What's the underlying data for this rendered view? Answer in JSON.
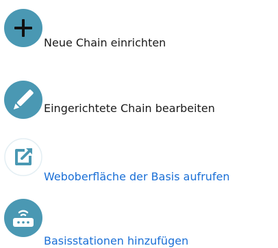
{
  "items": [
    {
      "label": "Neue Chain einrichten",
      "icon": "plus-circle-icon",
      "link": false
    },
    {
      "label": "Eingerichtete Chain bearbeiten",
      "icon": "pencil-circle-icon",
      "link": false
    },
    {
      "label": "Weboberfläche der Basis aufrufen",
      "icon": "open-external-icon",
      "link": true
    },
    {
      "label": "Basisstationen hinzufügen",
      "icon": "router-circle-icon",
      "link": true
    }
  ],
  "colors": {
    "icon_teal": "#4a98b3",
    "icon_teal_light": "#e8f2f6",
    "link": "#1a6fd6",
    "text": "#1a1a1a"
  }
}
